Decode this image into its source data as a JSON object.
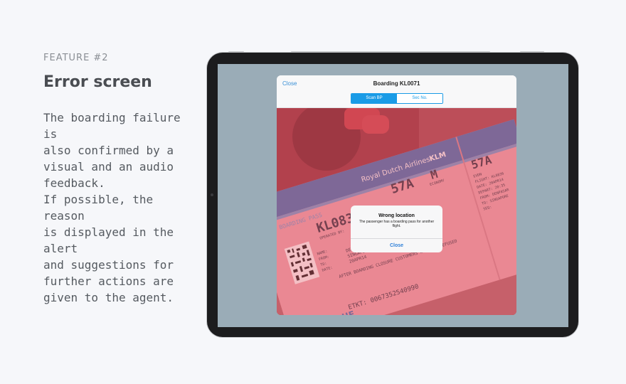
{
  "intro": {
    "kicker": "FEATURE #2",
    "title": "Error screen",
    "description": "The boarding failure is\nalso confirmed by a\nvisual and an audio\nfeedback.\nIf possible, the reason\nis displayed in the alert\nand suggestions for\nfurther actions are\ngiven to the agent."
  },
  "sheet": {
    "close_label": "Close",
    "title": "Boarding KL0071",
    "segments": [
      "Scan BP",
      "Sec No."
    ],
    "selected_segment": "Scan BP"
  },
  "boarding_pass": {
    "airline": "Royal Dutch Airlines",
    "brand": "KLM",
    "pass_label": "BOARDING PASS",
    "flight": "KL0836",
    "seat": "57A",
    "seat_alt": "57A",
    "class_code": "M",
    "cabin": "ECONOMY",
    "operated_by": "OPERATED BY:",
    "name_label": "NAME:",
    "from_label": "FROM:",
    "to_label": "TO:",
    "date_label": "DATE:",
    "from": "DENPASAR-BAL",
    "to": "SINGAPORE",
    "date": "20APR14",
    "notice": "AFTER BOARDING CLOSURE CUSTOMERS WILL BE REFUSED",
    "ticket": "ETKT: 0067352540990",
    "program": "FLYING BLUE",
    "stub_lines": [
      "EVDN",
      "FLIGHT: KL0836",
      "DATE: 20APR14",
      "DEPART: 20:35",
      "FROM: DENPASAR",
      "TO: SINGAPORE",
      "SEQ:"
    ]
  },
  "alert": {
    "title": "Wrong location",
    "message": "The passenger has a boarding pass for another flight.",
    "button": "Close"
  },
  "colors": {
    "page_bg": "#f6f7fa",
    "tablet_bezel": "#1c1c1e",
    "screen_bg": "#9aacb7",
    "accent": "#1a9be6",
    "error_overlay": "#e04a5a"
  }
}
